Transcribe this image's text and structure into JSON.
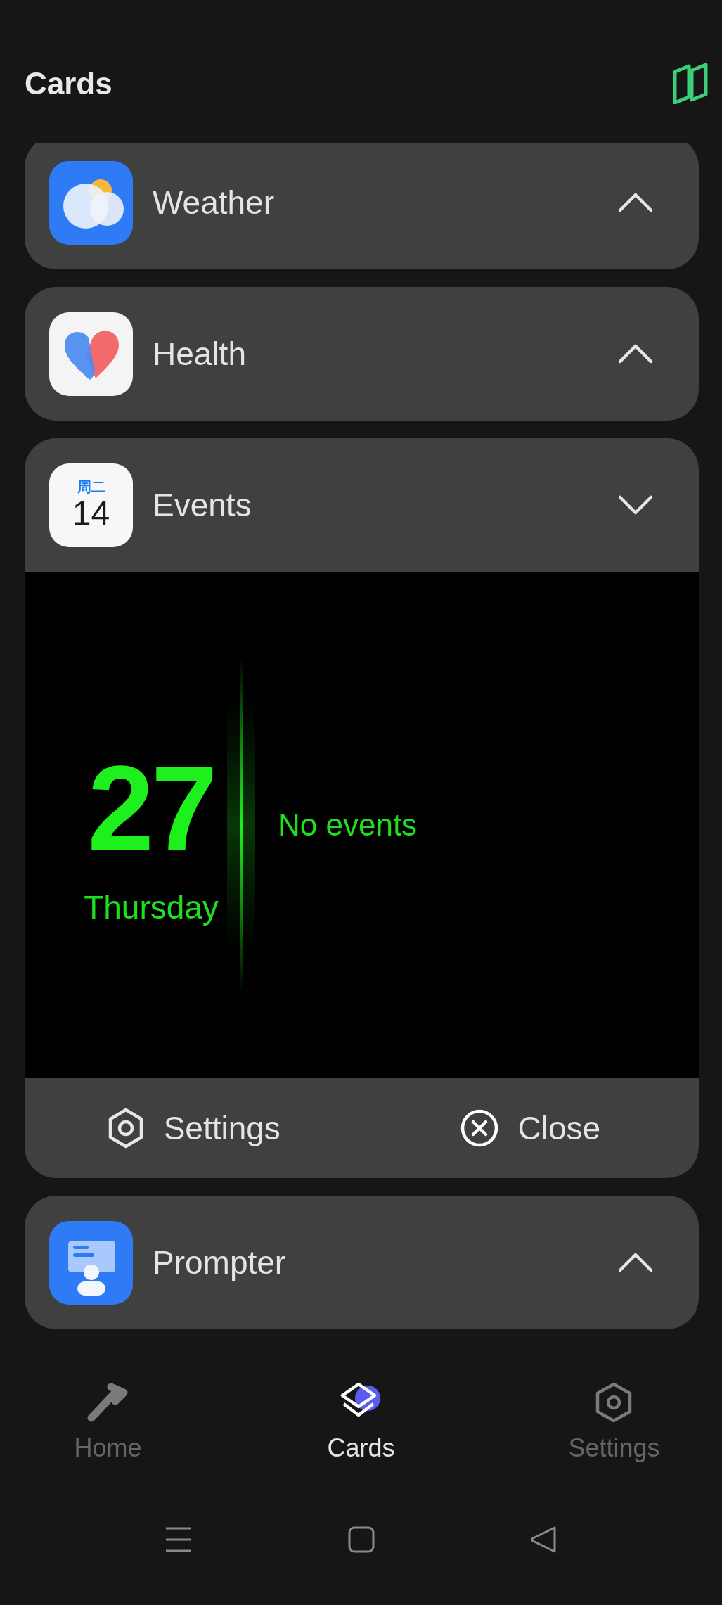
{
  "header": {
    "title": "Cards"
  },
  "cards": [
    {
      "kind": "weather",
      "title": "Weather",
      "expanded": false
    },
    {
      "kind": "health",
      "title": "Health",
      "expanded": false
    },
    {
      "kind": "events",
      "title": "Events",
      "expanded": true,
      "icon_weekday": "周二",
      "icon_day": "14",
      "widget": {
        "day": "27",
        "weekday": "Thursday",
        "message": "No events"
      },
      "actions": [
        {
          "kind": "settings",
          "label": "Settings"
        },
        {
          "kind": "close",
          "label": "Close"
        }
      ]
    },
    {
      "kind": "prompter",
      "title": "Prompter",
      "expanded": false
    }
  ],
  "bottom_nav": [
    {
      "kind": "home",
      "label": "Home",
      "selected": false
    },
    {
      "kind": "cards",
      "label": "Cards",
      "selected": true
    },
    {
      "kind": "settings",
      "label": "Settings",
      "selected": false
    }
  ]
}
